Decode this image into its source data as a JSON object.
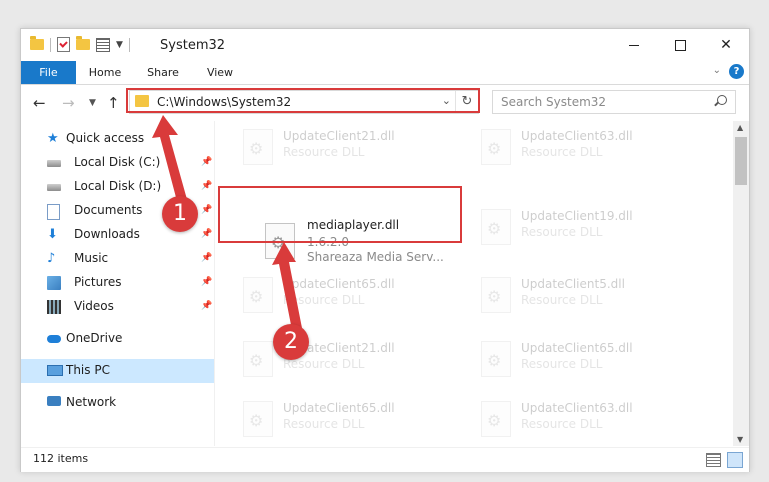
{
  "window": {
    "title": "System32"
  },
  "ribbon": {
    "tabs": [
      "File",
      "Home",
      "Share",
      "View"
    ],
    "help": "?"
  },
  "address": {
    "path": "C:\\Windows\\System32",
    "search_placeholder": "Search System32"
  },
  "nav_pane": {
    "items": [
      {
        "label": "Quick access",
        "icon": "star-icon"
      },
      {
        "label": "Local Disk (C:)",
        "icon": "disk-icon",
        "pinned": true
      },
      {
        "label": "Local Disk (D:)",
        "icon": "disk-icon",
        "pinned": true
      },
      {
        "label": "Documents",
        "icon": "documents-icon",
        "pinned": true
      },
      {
        "label": "Downloads",
        "icon": "download-icon",
        "pinned": true
      },
      {
        "label": "Music",
        "icon": "music-icon",
        "pinned": true
      },
      {
        "label": "Pictures",
        "icon": "pictures-icon",
        "pinned": true
      },
      {
        "label": "Videos",
        "icon": "videos-icon",
        "pinned": true
      },
      {
        "label": "OneDrive",
        "icon": "cloud-icon"
      },
      {
        "label": "This PC",
        "icon": "pc-icon",
        "selected": true
      },
      {
        "label": "Network",
        "icon": "network-icon"
      }
    ]
  },
  "files": {
    "highlighted": {
      "name": "mediaplayer.dll",
      "version": "1.6.2.0",
      "description": "Shareaza Media Serv..."
    },
    "background": [
      {
        "name": "UpdateClient21.dll",
        "type": "Resource DLL"
      },
      {
        "name": "UpdateClient63.dll",
        "type": "Resource DLL"
      },
      {
        "name": "UpdateClient19.dll",
        "type": "Resource DLL"
      },
      {
        "name": "UpdateClient65.dll",
        "type": "Resource DLL"
      },
      {
        "name": "UpdateClient5.dll",
        "type": "Resource DLL"
      },
      {
        "name": "UpdateClient21.dll",
        "type": "Resource DLL"
      },
      {
        "name": "UpdateClient65.dll",
        "type": "Resource DLL"
      },
      {
        "name": "UpdateClient65.dll",
        "type": "Resource DLL"
      },
      {
        "name": "UpdateClient63.dll",
        "type": "Resource DLL"
      }
    ]
  },
  "status": {
    "item_count": "112 items"
  },
  "callouts": {
    "step1": "1",
    "step2": "2",
    "color": "#d93b3b"
  }
}
